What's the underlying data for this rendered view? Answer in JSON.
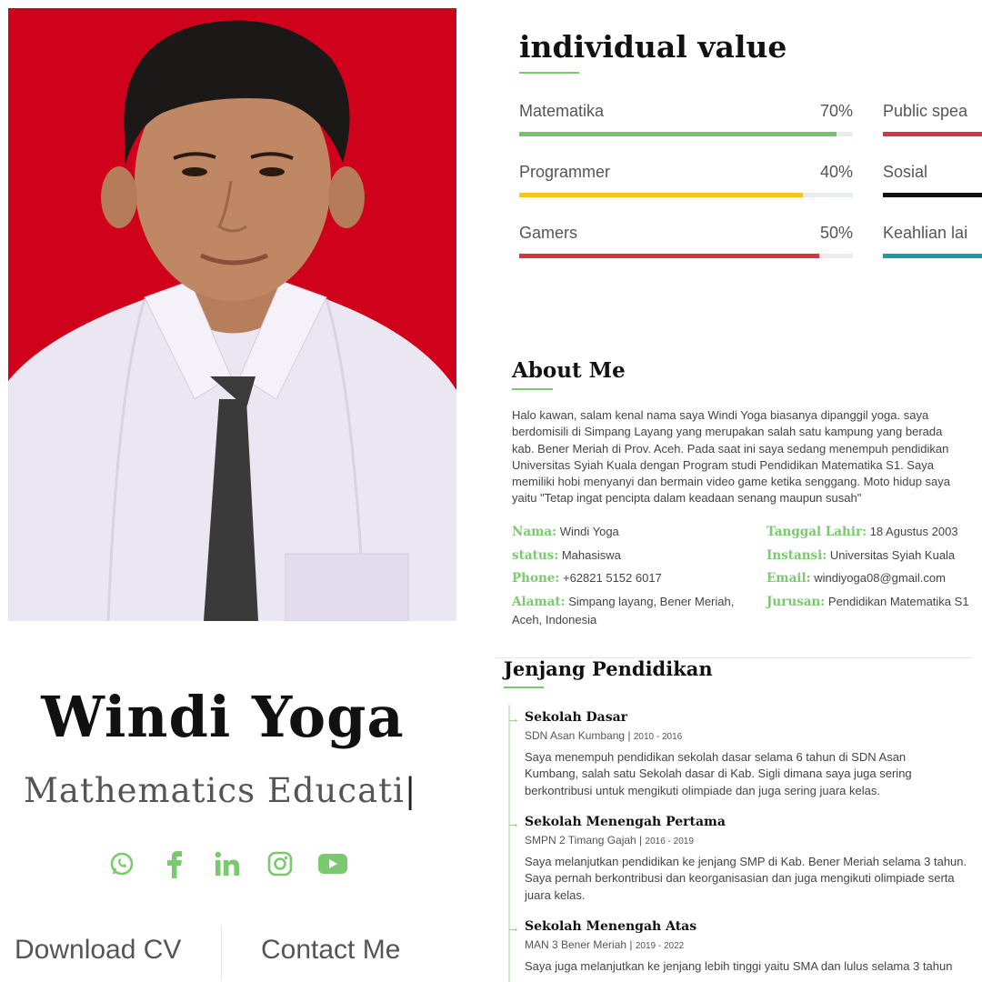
{
  "profile": {
    "name": "Windi Yoga",
    "subtitle": "Mathematics Educati",
    "cursor": "|",
    "download_cv": "Download CV",
    "contact_me": "Contact Me",
    "socials": [
      "whatsapp-icon",
      "facebook-icon",
      "linkedin-icon",
      "instagram-icon",
      "youtube-icon"
    ],
    "accent_color": "#7bc96f",
    "photo_background_color": "#d0021b"
  },
  "skills": {
    "title": "individual value",
    "items": [
      {
        "label": "Matematika",
        "percent": "70%",
        "fill": 0.95,
        "color": "#72c36a"
      },
      {
        "label": "Programmer",
        "percent": "40%",
        "fill": 0.85,
        "color": "#f5c518"
      },
      {
        "label": "Gamers",
        "percent": "50%",
        "fill": 0.9,
        "color": "#d63447"
      },
      {
        "label": "Public spea",
        "percent": "",
        "fill": 1.0,
        "color": "#d63447"
      },
      {
        "label": "Sosial",
        "percent": "",
        "fill": 1.0,
        "color": "#111111"
      },
      {
        "label": "Keahlian lai",
        "percent": "",
        "fill": 1.0,
        "color": "#1b9aaa"
      }
    ]
  },
  "about": {
    "title": "About Me",
    "lines": [
      "Halo kawan, salam kenal nama saya Windi Yoga biasanya dipanggil yoga. saya",
      "berdomisili di Simpang Layang yang merupakan salah satu kampung yang berada",
      "kab. Bener Meriah di Prov. Aceh. Pada saat ini saya sedang menempuh pendidikan",
      "Universitas Syiah Kuala dengan Program studi Pendidikan Matematika S1. Saya",
      "memiliki hobi menyanyi dan bermain video game ketika senggang. Moto hidup saya",
      "yaitu \"Tetap ingat pencipta dalam keadaan senang maupun susah\""
    ],
    "info": [
      {
        "key": "Nama:",
        "value": "Windi Yoga"
      },
      {
        "key": "status:",
        "value": "Mahasiswa"
      },
      {
        "key": "Phone:",
        "value": "+62821 5152 6017"
      },
      {
        "key": "Alamat:",
        "value": "Simpang layang, Bener Meriah,",
        "value2": "Aceh, Indonesia"
      },
      {
        "key": "Tanggal Lahir:",
        "value": "18 Agustus 2003"
      },
      {
        "key": "Instansi:",
        "value": "Universitas Syiah Kuala"
      },
      {
        "key": "Email:",
        "value": "windiyoga08@gmail.com"
      },
      {
        "key": "Jurusan:",
        "value": "Pendidikan Matematika S1"
      }
    ]
  },
  "education": {
    "title": "Jenjang Pendidikan",
    "items": [
      {
        "title": "Sekolah Dasar",
        "school": "SDN Asan Kumbang | ",
        "years": "2010 - 2016",
        "lines": [
          "Saya menempuh pendidikan sekolah dasar selama 6 tahun di SDN Asan",
          "Kumbang, salah satu Sekolah dasar di Kab. Sigli dimana saya juga sering",
          "berkontribusi untuk mengikuti olimpiade dan juga sering juara kelas."
        ]
      },
      {
        "title": "Sekolah Menengah Pertama",
        "school": "SMPN 2 Timang Gajah | ",
        "years": "2016 - 2019",
        "lines": [
          "Saya melanjutkan pendidikan ke jenjang SMP di Kab. Bener Meriah selama 3 tahun.",
          "Saya pernah berkontribusi dan keorganisasian dan juga mengikuti olimpiade serta",
          "juara kelas."
        ]
      },
      {
        "title": "Sekolah Menengah Atas",
        "school": "MAN 3 Bener Meriah | ",
        "years": "2019 - 2022",
        "lines": [
          "Saya juga melanjutkan ke jenjang lebih tinggi yaitu SMA dan lulus selama 3 tahun"
        ]
      }
    ]
  }
}
